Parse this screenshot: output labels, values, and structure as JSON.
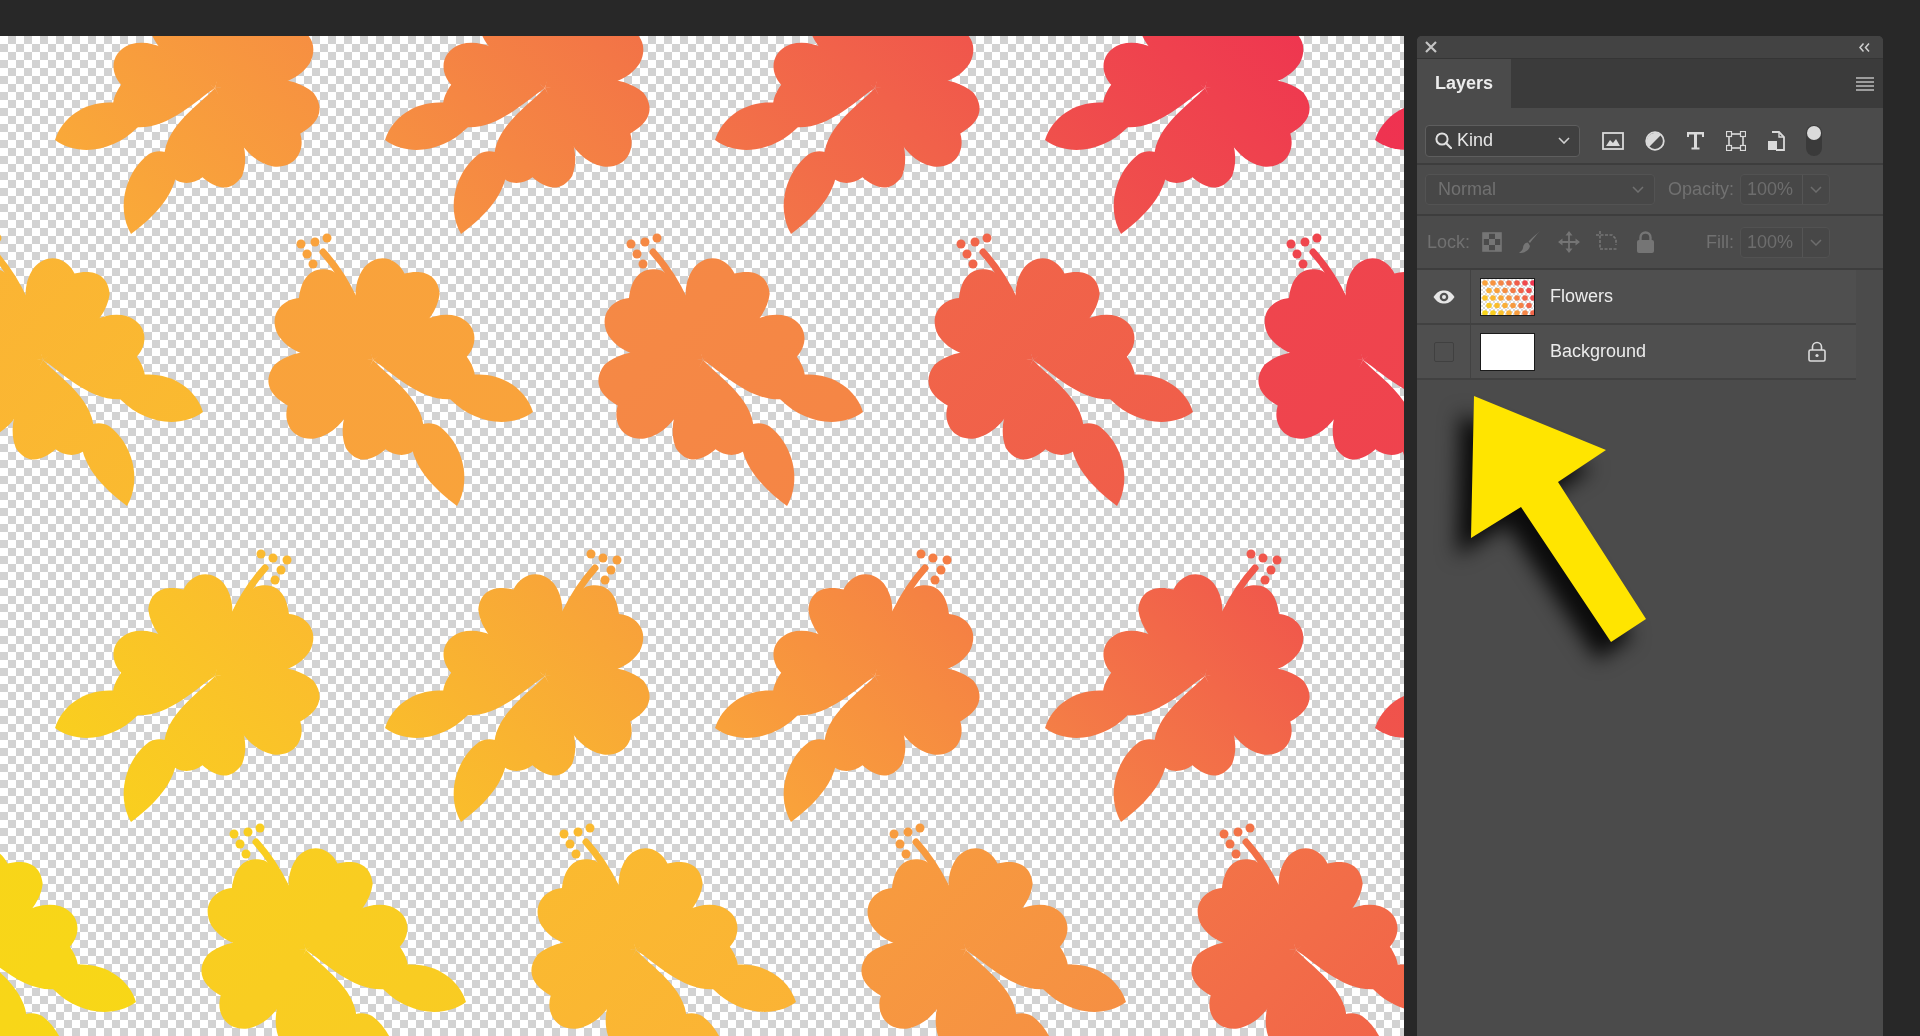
{
  "panel": {
    "tabs": [
      {
        "label": "Layers",
        "selected": true
      }
    ],
    "filter": {
      "label": "Kind",
      "on": true
    },
    "blend_mode": {
      "value": "Normal",
      "disabled": true
    },
    "opacity": {
      "label": "Opacity:",
      "value": "100%",
      "disabled": true
    },
    "lock": {
      "label": "Lock:",
      "disabled": true
    },
    "fill": {
      "label": "Fill:",
      "value": "100%",
      "disabled": true
    },
    "layers": [
      {
        "name": "Flowers",
        "kind": "pattern",
        "visible": true,
        "locked": false,
        "selected": false
      },
      {
        "name": "Background",
        "kind": "solid",
        "visible": false,
        "locked": true,
        "selected": false
      }
    ]
  }
}
